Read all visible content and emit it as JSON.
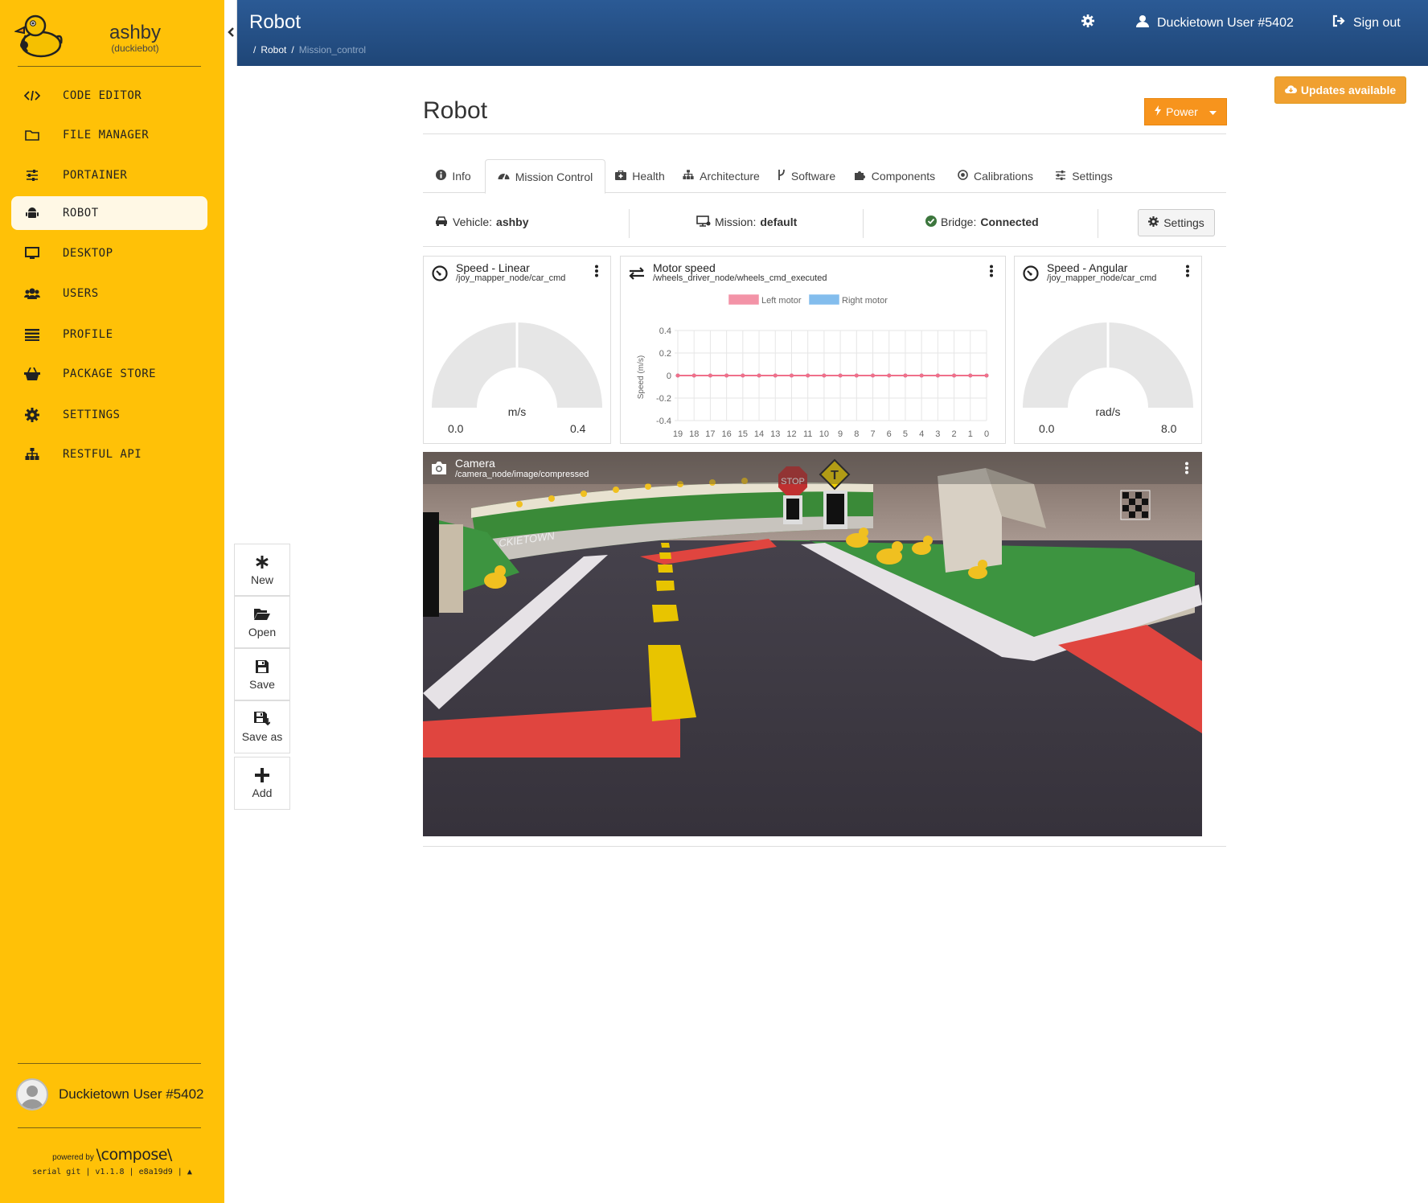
{
  "sidebar": {
    "robot_name": "ashby",
    "robot_type": "(duckiebot)",
    "items": [
      {
        "label": "CODE EDITOR",
        "icon": "code-icon"
      },
      {
        "label": "FILE MANAGER",
        "icon": "folder-icon"
      },
      {
        "label": "PORTAINER",
        "icon": "sliders-icon"
      },
      {
        "label": "ROBOT",
        "icon": "android-icon",
        "active": true
      },
      {
        "label": "DESKTOP",
        "icon": "desktop-icon"
      },
      {
        "label": "USERS",
        "icon": "users-icon"
      },
      {
        "label": "PROFILE",
        "icon": "list-icon"
      },
      {
        "label": "PACKAGE STORE",
        "icon": "shopping-basket-icon"
      },
      {
        "label": "SETTINGS",
        "icon": "gear-icon"
      },
      {
        "label": "RESTFUL API",
        "icon": "sitemap-icon"
      }
    ],
    "user_name": "Duckietown User #5402",
    "powered_by": "powered by",
    "brand": "\\compose\\",
    "version_text": "serial git | v1.1.8 | e8a19d9 |"
  },
  "header": {
    "title": "Robot",
    "breadcrumb": [
      "Robot",
      "Mission_control"
    ],
    "user_name": "Duckietown User #5402",
    "sign_out": "Sign out"
  },
  "updates_label": "Updates available",
  "page": {
    "title": "Robot",
    "power_label": "Power"
  },
  "tabs": [
    {
      "label": "Info",
      "icon": "info-icon"
    },
    {
      "label": "Mission Control",
      "icon": "dashboard-icon",
      "active": true
    },
    {
      "label": "Health",
      "icon": "medkit-icon"
    },
    {
      "label": "Architecture",
      "icon": "sitemap-icon"
    },
    {
      "label": "Software",
      "icon": "code-fork-icon"
    },
    {
      "label": "Components",
      "icon": "puzzle-icon"
    },
    {
      "label": "Calibrations",
      "icon": "dot-circle-icon"
    },
    {
      "label": "Settings",
      "icon": "sliders-icon"
    }
  ],
  "status": {
    "vehicle_label": "Vehicle:",
    "vehicle": "ashby",
    "mission_label": "Mission:",
    "mission": "default",
    "bridge_label": "Bridge:",
    "bridge": "Connected",
    "settings_label": "Settings",
    "bridge_color": "#3c763d"
  },
  "panels": {
    "speed_linear": {
      "title": "Speed - Linear",
      "topic": "/joy_mapper_node/car_cmd",
      "unit": "m/s",
      "min": "0.0",
      "max": "0.4",
      "value": 0
    },
    "motor_speed": {
      "title": "Motor speed",
      "topic": "/wheels_driver_node/wheels_cmd_executed"
    },
    "speed_angular": {
      "title": "Speed - Angular",
      "topic": "/joy_mapper_node/car_cmd",
      "unit": "rad/s",
      "min": "0.0",
      "max": "8.0",
      "value": 0
    }
  },
  "chart_data": {
    "type": "line",
    "x": [
      "19",
      "18",
      "17",
      "16",
      "15",
      "14",
      "13",
      "12",
      "11",
      "10",
      "9",
      "8",
      "7",
      "6",
      "5",
      "4",
      "3",
      "2",
      "1",
      "0"
    ],
    "series": [
      {
        "name": "Left motor",
        "color": "#f0708a",
        "values": [
          0,
          0,
          0,
          0,
          0,
          0,
          0,
          0,
          0,
          0,
          0,
          0,
          0,
          0,
          0,
          0,
          0,
          0,
          0,
          0
        ]
      },
      {
        "name": "Right motor",
        "color": "#5aa8e8",
        "values": [
          0,
          0,
          0,
          0,
          0,
          0,
          0,
          0,
          0,
          0,
          0,
          0,
          0,
          0,
          0,
          0,
          0,
          0,
          0,
          0
        ]
      }
    ],
    "ylabel": "Speed (m/s)",
    "yticks": [
      "0.4",
      "0.2",
      "0",
      "-0.2",
      "-0.4"
    ],
    "ylim": [
      -0.4,
      0.4
    ],
    "grid": true,
    "legend": "top"
  },
  "camera": {
    "title": "Camera",
    "topic": "/camera_node/image/compressed",
    "scene_text": {
      "stop_sign": "STOP",
      "sign_t": "T",
      "wall": "CKIETOWN"
    }
  },
  "toolbar": [
    {
      "label": "New",
      "icon": "asterisk-icon"
    },
    {
      "label": "Open",
      "icon": "folder-open-icon"
    },
    {
      "label": "Save",
      "icon": "floppy-icon"
    },
    {
      "label": "Save as",
      "icon": "floppy-save-as-icon"
    },
    {
      "label": "Add",
      "icon": "plus-icon"
    }
  ],
  "colors": {
    "sidebar": "#FFC107",
    "header": "#234d82",
    "power": "#F7941D",
    "updates": "#F0A030"
  }
}
